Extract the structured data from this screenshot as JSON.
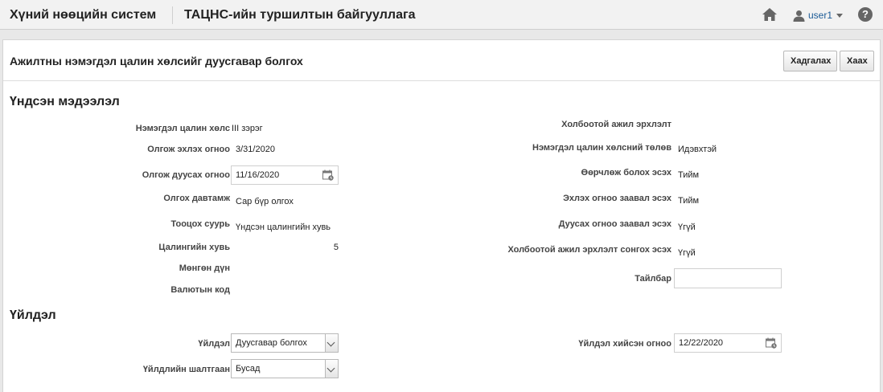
{
  "header": {
    "app_title": "Хүний нөөцийн систем",
    "org_title": "ТАЦНС-ийн туршилтын байгууллага",
    "user": "user1",
    "help": "?"
  },
  "page": {
    "title": "Ажилтны нэмэгдэл цалин хөлсийг дуусгавар болгох",
    "save_label": "Хадгалах",
    "close_label": "Хаах"
  },
  "basic_info": {
    "section_title": "Үндсэн мэдээлэл",
    "left": {
      "bonus_type_label": "Нэмэгдэл цалин хөлс",
      "bonus_type": "III зэрэг",
      "start_date_label": "Олгож эхлэх огноо",
      "start_date": "3/31/2020",
      "end_date_label": "Олгож дуусах огноо",
      "end_date": "11/16/2020",
      "frequency_label": "Олгох давтамж",
      "frequency": "Сар бүр олгох",
      "calc_base_label": "Тооцох суурь",
      "calc_base": "Үндсэн цалингийн хувь",
      "percent_label": "Цалингийн хувь",
      "percent": "5",
      "amount_label": "Мөнгөн дүн",
      "currency_label": "Валютын код"
    },
    "right": {
      "linked_job_label": "Холбоотой ажил эрхлэлт",
      "bonus_status_label": "Нэмэгдэл цалин хөлсний төлөв",
      "bonus_status": "Идэвхтэй",
      "replaceable_label": "Өөрчлөж болох эсэх",
      "replaceable": "Тийм",
      "start_required_label": "Эхлэх огноо заавал эсэх",
      "start_required": "Тийм",
      "end_required_label": "Дуусах огноо заавал эсэх",
      "end_required": "Үгүй",
      "choose_linked_label": "Холбоотой ажил эрхлэлт сонгох эсэх",
      "choose_linked": "Үгүй",
      "note_label": "Тайлбар",
      "note": ""
    }
  },
  "action": {
    "section_title": "Үйлдэл",
    "action_label": "Үйлдэл",
    "action_value": "Дуусгавар болгох",
    "reason_label": "Үйлдлийн шалтгаан",
    "reason_value": "Бусад",
    "action_date_label": "Үйлдэл хийсэн огноо",
    "action_date": "12/22/2020"
  }
}
